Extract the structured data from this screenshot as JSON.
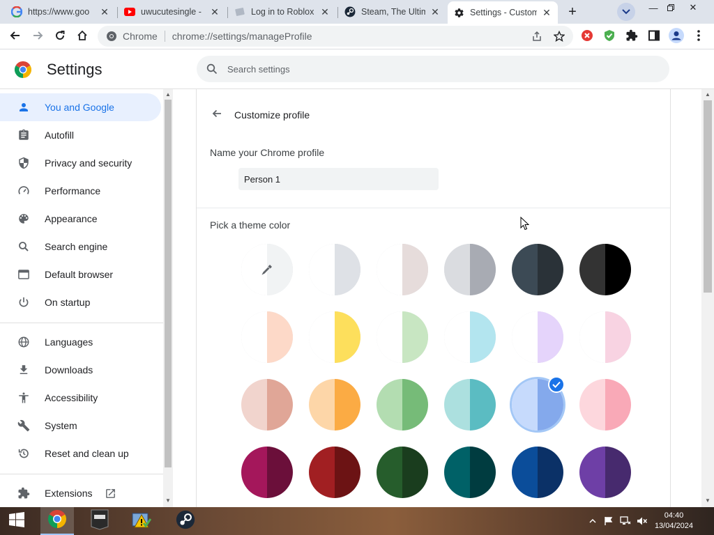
{
  "tabs": [
    {
      "title": "https://www.goo",
      "icon": "google-icon"
    },
    {
      "title": "uwucutesingle -",
      "icon": "youtube-icon"
    },
    {
      "title": "Log in to Roblox",
      "icon": "roblox-icon"
    },
    {
      "title": "Steam, The Ultim",
      "icon": "steam-icon"
    },
    {
      "title": "Settings - Custom",
      "icon": "gear-icon",
      "active": true
    }
  ],
  "toolbar": {
    "chip": "Chrome",
    "url": "chrome://settings/manageProfile"
  },
  "header": {
    "title": "Settings",
    "search_placeholder": "Search settings"
  },
  "sidebar": {
    "items": [
      {
        "label": "You and Google",
        "icon": "person-icon",
        "active": true
      },
      {
        "label": "Autofill",
        "icon": "clipboard-icon"
      },
      {
        "label": "Privacy and security",
        "icon": "shield-icon"
      },
      {
        "label": "Performance",
        "icon": "speedometer-icon"
      },
      {
        "label": "Appearance",
        "icon": "palette-icon"
      },
      {
        "label": "Search engine",
        "icon": "search-icon"
      },
      {
        "label": "Default browser",
        "icon": "browser-window-icon"
      },
      {
        "label": "On startup",
        "icon": "power-icon"
      },
      {
        "label": "Languages",
        "icon": "globe-icon"
      },
      {
        "label": "Downloads",
        "icon": "download-icon"
      },
      {
        "label": "Accessibility",
        "icon": "accessibility-icon"
      },
      {
        "label": "System",
        "icon": "wrench-icon"
      },
      {
        "label": "Reset and clean up",
        "icon": "history-icon"
      },
      {
        "label": "Extensions",
        "icon": "puzzle-icon"
      }
    ]
  },
  "main": {
    "title": "Customize profile",
    "name_label": "Name your Chrome profile",
    "name_value": "Person 1",
    "theme_label": "Pick a theme color"
  },
  "theme_colors": [
    {
      "left": "#ffffff",
      "right": "#f1f3f4",
      "picker": true
    },
    {
      "left": "#ffffff",
      "right": "#dee1e6"
    },
    {
      "left": "#ffffff",
      "right": "#e6dcdb"
    },
    {
      "left": "#dadce0",
      "right": "#a8abb3"
    },
    {
      "left": "#3c4a55",
      "right": "#2a3238"
    },
    {
      "left": "#333333",
      "right": "#000000"
    },
    {
      "left": "#ffffff",
      "right": "#fdd9c8"
    },
    {
      "left": "#ffffff",
      "right": "#fddf5c"
    },
    {
      "left": "#ffffff",
      "right": "#c8e6c2"
    },
    {
      "left": "#ffffff",
      "right": "#b3e5ef"
    },
    {
      "left": "#ffffff",
      "right": "#e5d4fb"
    },
    {
      "left": "#ffffff",
      "right": "#f8d3e2"
    },
    {
      "left": "#f1d4cd",
      "right": "#e0a697"
    },
    {
      "left": "#fdd6a8",
      "right": "#fbab44"
    },
    {
      "left": "#b3ddb1",
      "right": "#76bb78"
    },
    {
      "left": "#ace0df",
      "right": "#5bbcc2"
    },
    {
      "left": "#c6dafc",
      "right": "#84a9ec",
      "selected": true
    },
    {
      "left": "#fdd7dd",
      "right": "#f9a9b7"
    },
    {
      "left": "#a4175b",
      "right": "#6b0f3a"
    },
    {
      "left": "#a11f22",
      "right": "#6c1314"
    },
    {
      "left": "#265d2c",
      "right": "#1a3d1e"
    },
    {
      "left": "#006167",
      "right": "#003c40"
    },
    {
      "left": "#0b4d9a",
      "right": "#0b3167"
    },
    {
      "left": "#6e3fa6",
      "right": "#472a6e"
    }
  ],
  "taskbar": {
    "time": "04:40",
    "date": "13/04/2024"
  },
  "colors": {
    "accent": "#1a73e8",
    "active_nav_bg": "#e8f0fe"
  }
}
